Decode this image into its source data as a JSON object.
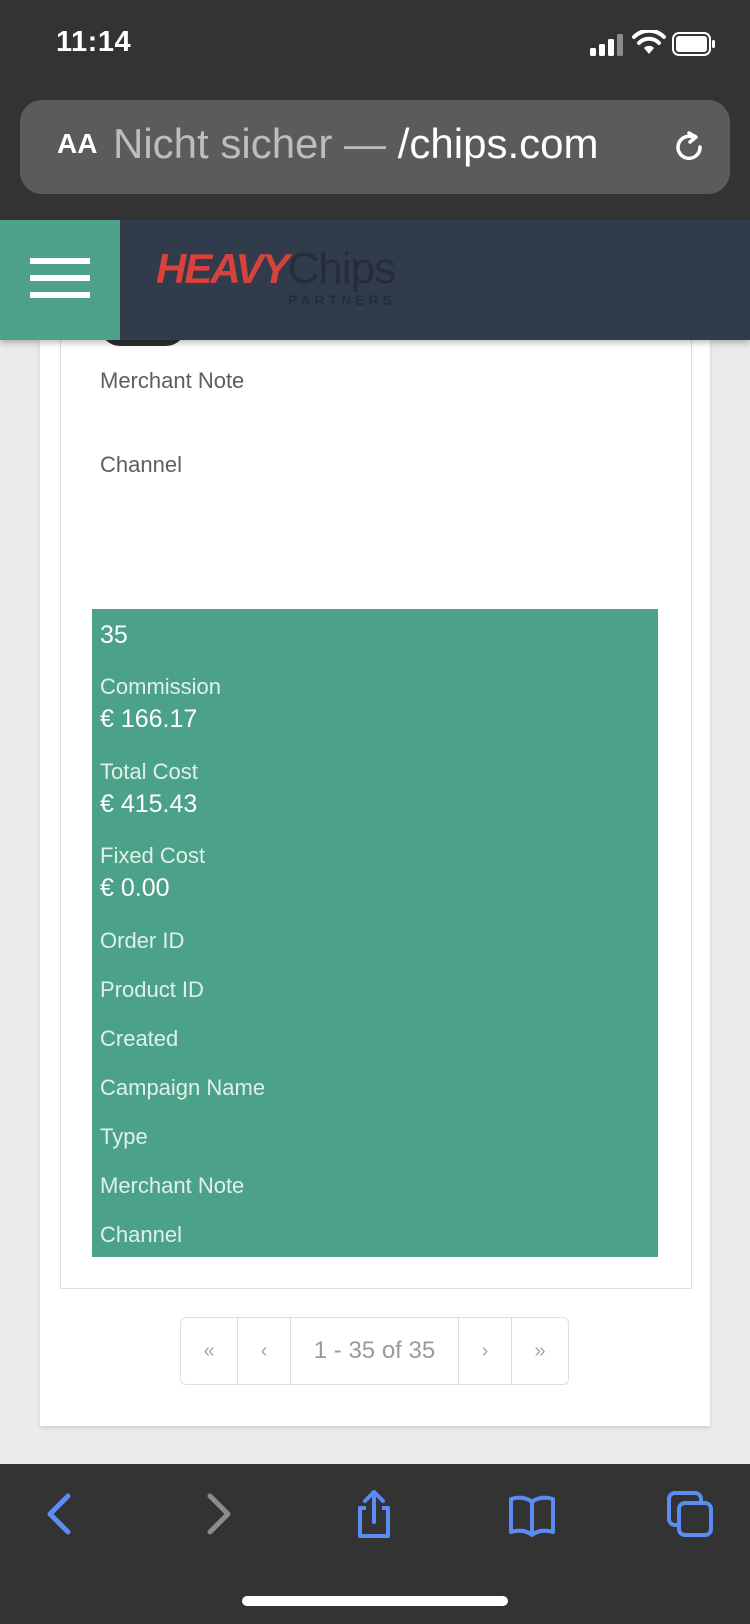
{
  "status_bar": {
    "time": "11:14"
  },
  "browser": {
    "aa_label": "AA",
    "url_prefix": "Nicht sicher — ",
    "url_domain": "/chips.com"
  },
  "header": {
    "logo_heavy": "HEAVY",
    "logo_chips": "Chips",
    "logo_partners": "PARTNERS"
  },
  "previous_record": {
    "labels": [
      "Merchant Note",
      "Channel"
    ]
  },
  "highlighted_record": {
    "number": "35",
    "commission_label": "Commission",
    "commission_value": "€ 166.17",
    "total_cost_label": "Total Cost",
    "total_cost_value": "€ 415.43",
    "fixed_cost_label": "Fixed Cost",
    "fixed_cost_value": "€ 0.00",
    "order_id_label": "Order ID",
    "product_id_label": "Product ID",
    "created_label": "Created",
    "campaign_name_label": "Campaign Name",
    "type_label": "Type",
    "merchant_note_label": "Merchant Note",
    "channel_label": "Channel"
  },
  "pagination": {
    "first": "«",
    "prev": "‹",
    "info": "1 - 35 of 35",
    "next": "›",
    "last": "»"
  },
  "colors": {
    "accent_green": "#4ca288",
    "header_bg": "#303b4c",
    "logo_red": "#d9423c",
    "toolbar_blue": "#5b8cf5"
  }
}
